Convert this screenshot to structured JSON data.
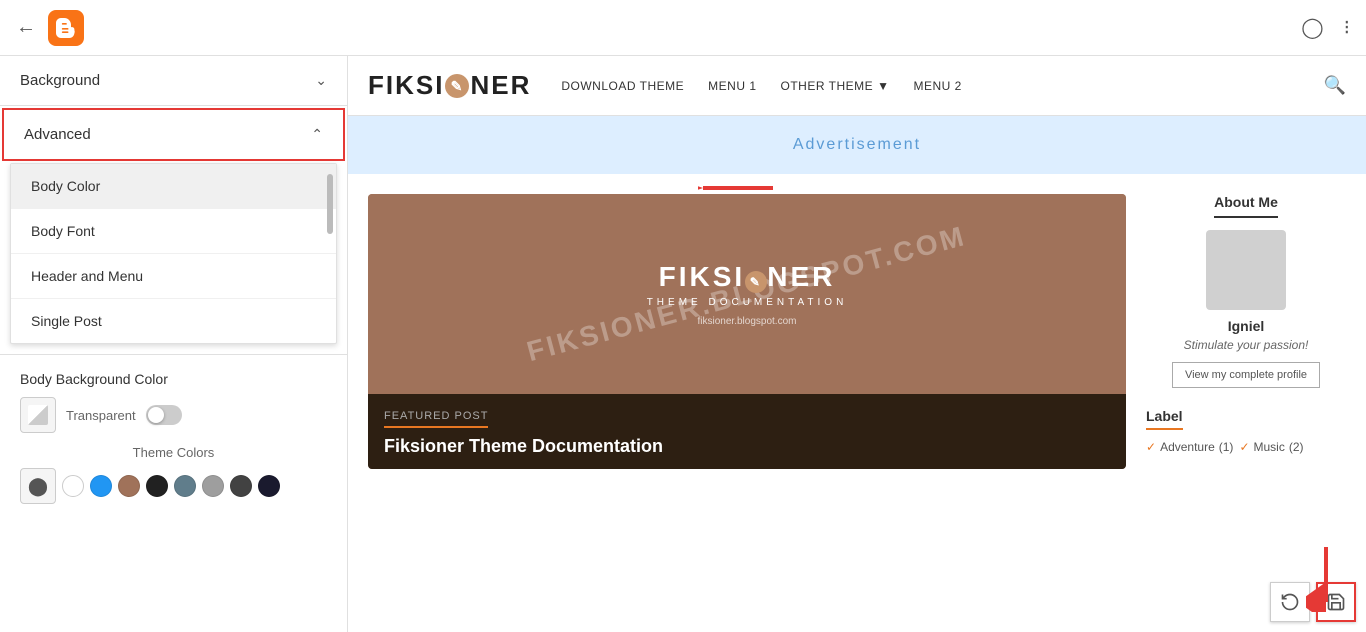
{
  "topbar": {
    "back_label": "←",
    "help_label": "?",
    "grid_label": "⋮⋮⋮"
  },
  "sidebar": {
    "background_label": "Background",
    "advanced_label": "Advanced",
    "dropdown_items": [
      {
        "id": "body-color",
        "label": "Body Color",
        "selected": true
      },
      {
        "id": "body-font",
        "label": "Body Font",
        "selected": false
      },
      {
        "id": "header-menu",
        "label": "Header and Menu",
        "selected": false
      },
      {
        "id": "single-post",
        "label": "Single Post",
        "selected": false
      }
    ],
    "body_bg_color_label": "Body Background Color",
    "transparent_label": "Transparent",
    "theme_colors_label": "Theme Colors",
    "colors": [
      {
        "hex": "#ffffff",
        "name": "white"
      },
      {
        "hex": "#2196F3",
        "name": "blue"
      },
      {
        "hex": "#a0725a",
        "name": "brown"
      },
      {
        "hex": "#212121",
        "name": "black"
      },
      {
        "hex": "#607D8B",
        "name": "blue-grey"
      },
      {
        "hex": "#9E9E9E",
        "name": "grey"
      },
      {
        "hex": "#424242",
        "name": "dark-grey"
      },
      {
        "hex": "#1a1a2e",
        "name": "dark-navy"
      }
    ],
    "color_picker_icon": "🎨"
  },
  "preview": {
    "logo": "FIKSIONER",
    "nav_items": [
      {
        "label": "DOWNLOAD THEME"
      },
      {
        "label": "Menu 1"
      },
      {
        "label": "Other Theme",
        "has_arrow": true
      },
      {
        "label": "Menu 2"
      }
    ],
    "ad_text": "Advertisement",
    "featured_logo": "FIKSIONER",
    "featured_sub": "THEME DOCUMENTATION",
    "featured_url": "fiksioner.blogspot.com",
    "featured_watermark": "FIKSIONER.BLOGSPOT.COM",
    "featured_label": "Featured Post",
    "featured_title": "Fiksioner Theme Documentation",
    "about_title": "About Me",
    "about_name": "Igniel",
    "about_tagline": "Stimulate your passion!",
    "view_profile_label": "View my complete profile",
    "label_title": "Label",
    "label_items": [
      {
        "name": "Adventure",
        "count": "(1)"
      },
      {
        "name": "Music",
        "count": "(2)"
      }
    ]
  },
  "actions": {
    "save_icon": "💾",
    "revert_icon": "↩"
  }
}
